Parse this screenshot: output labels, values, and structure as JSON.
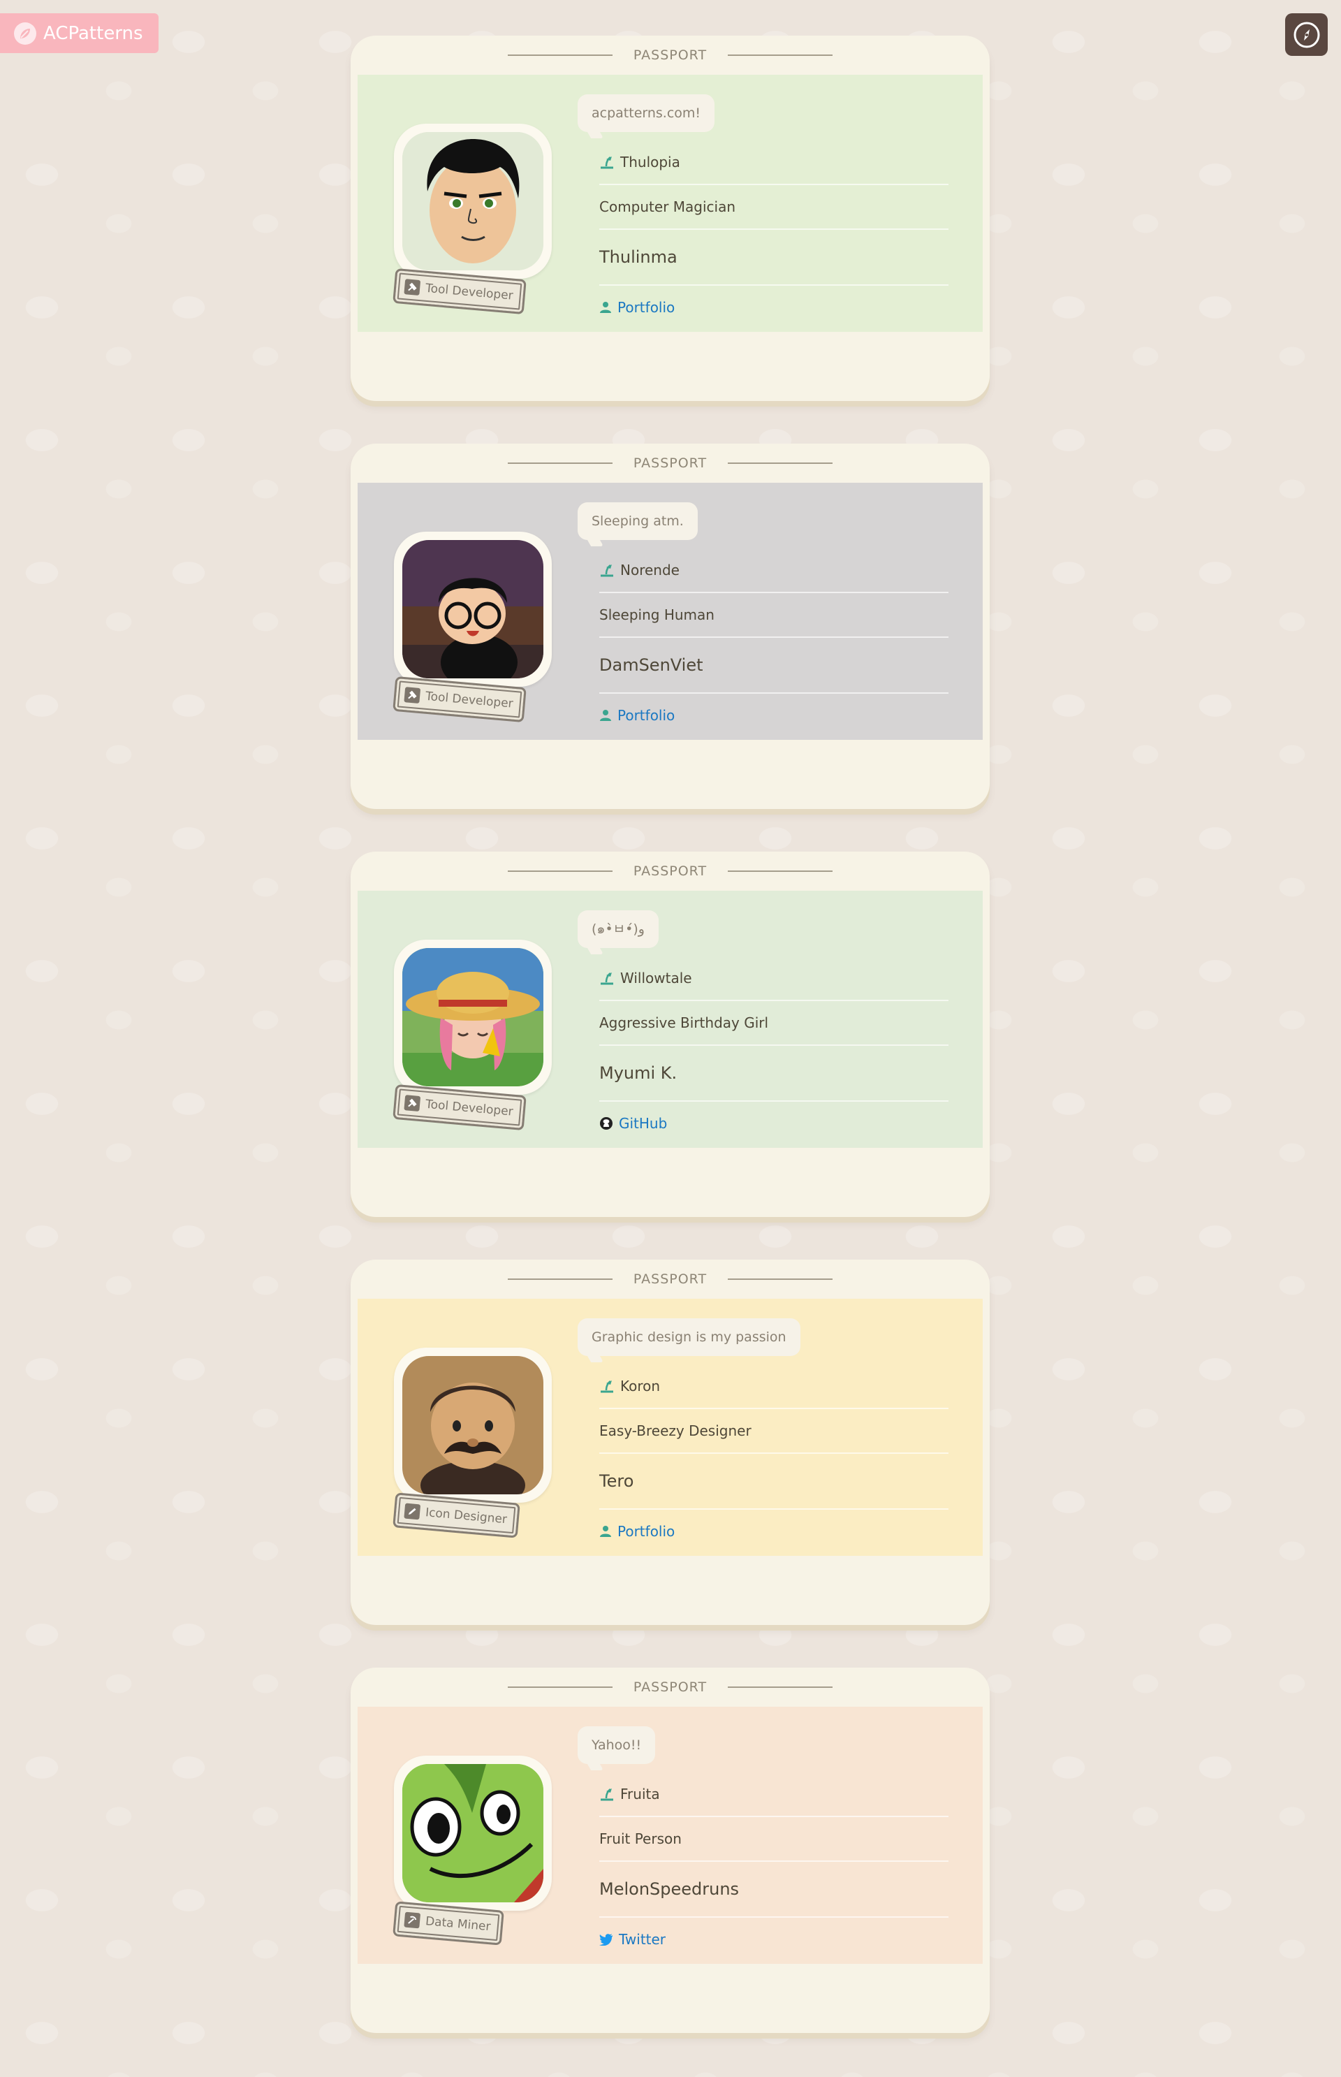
{
  "brand": {
    "name": "ACPatterns",
    "pink": "#f9b6bd"
  },
  "header": {
    "compass_icon": "compass-icon"
  },
  "card_header_title": "PASSPORT",
  "cards": [
    {
      "theme_color": "#e4efd4",
      "bubble": "acpatterns.com!",
      "island": "Thulopia",
      "title": "Computer Magician",
      "name": "Thulinma",
      "badge": "Tool Developer",
      "link_label": "Portfolio",
      "link_icon": "person-icon",
      "avatar_icon": "mii-avatar"
    },
    {
      "theme_color": "#d6d4d4",
      "bubble": "Sleeping atm.",
      "island": "Norende",
      "title": "Sleeping Human",
      "name": "DamSenViet",
      "badge": "Tool Developer",
      "link_label": "Portfolio",
      "link_icon": "person-icon",
      "avatar_icon": "villager-glasses-avatar"
    },
    {
      "theme_color": "#e1ecd8",
      "bubble": "(๑•̀ㅂ•́)و",
      "island": "Willowtale",
      "title": "Aggressive Birthday Girl",
      "name": "Myumi K.",
      "badge": "Tool Developer",
      "link_label": "GitHub",
      "link_icon": "github-icon",
      "avatar_icon": "villager-strawhat-avatar"
    },
    {
      "theme_color": "#fbedc3",
      "bubble": "Graphic design is my passion",
      "island": "Koron",
      "title": "Easy-Breezy Designer",
      "name": "Tero",
      "badge": "Icon Designer",
      "link_label": "Portfolio",
      "link_icon": "person-icon",
      "avatar_icon": "villager-mustache-avatar"
    },
    {
      "theme_color": "#f8e5d3",
      "bubble": "Yahoo!!",
      "island": "Fruita",
      "title": "Fruit Person",
      "name": "MelonSpeedruns",
      "badge": "Data Miner",
      "link_label": "Twitter",
      "link_icon": "twitter-icon",
      "avatar_icon": "yoshi-avatar"
    }
  ]
}
